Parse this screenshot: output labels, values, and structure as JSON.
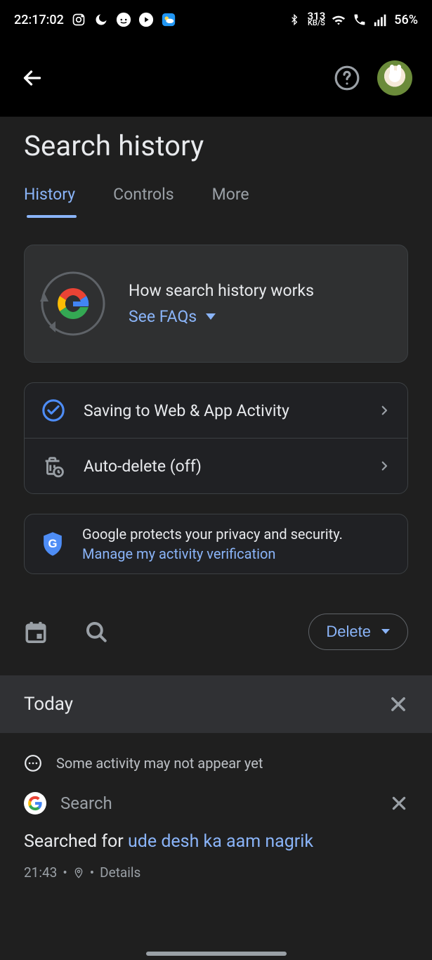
{
  "status_bar": {
    "time": "22:17:02",
    "data_rate_value": "313",
    "data_rate_unit": "KB/S",
    "battery": "56%"
  },
  "header": {
    "title": "Search history"
  },
  "tabs": {
    "history": "History",
    "controls": "Controls",
    "more": "More"
  },
  "faq": {
    "title": "How search history works",
    "link": "See FAQs"
  },
  "settings": {
    "saving": "Saving to Web & App Activity",
    "autodelete": "Auto-delete (off)"
  },
  "privacy": {
    "text": "Google protects your privacy and security.",
    "link": "Manage my activity verification"
  },
  "toolbar": {
    "delete": "Delete"
  },
  "today": {
    "label": "Today"
  },
  "activity": {
    "notice": "Some activity may not appear yet",
    "app": "Search",
    "prefix": "Searched for ",
    "query": "ude desh ka aam nagrik",
    "time": "21:43",
    "details": "Details"
  }
}
